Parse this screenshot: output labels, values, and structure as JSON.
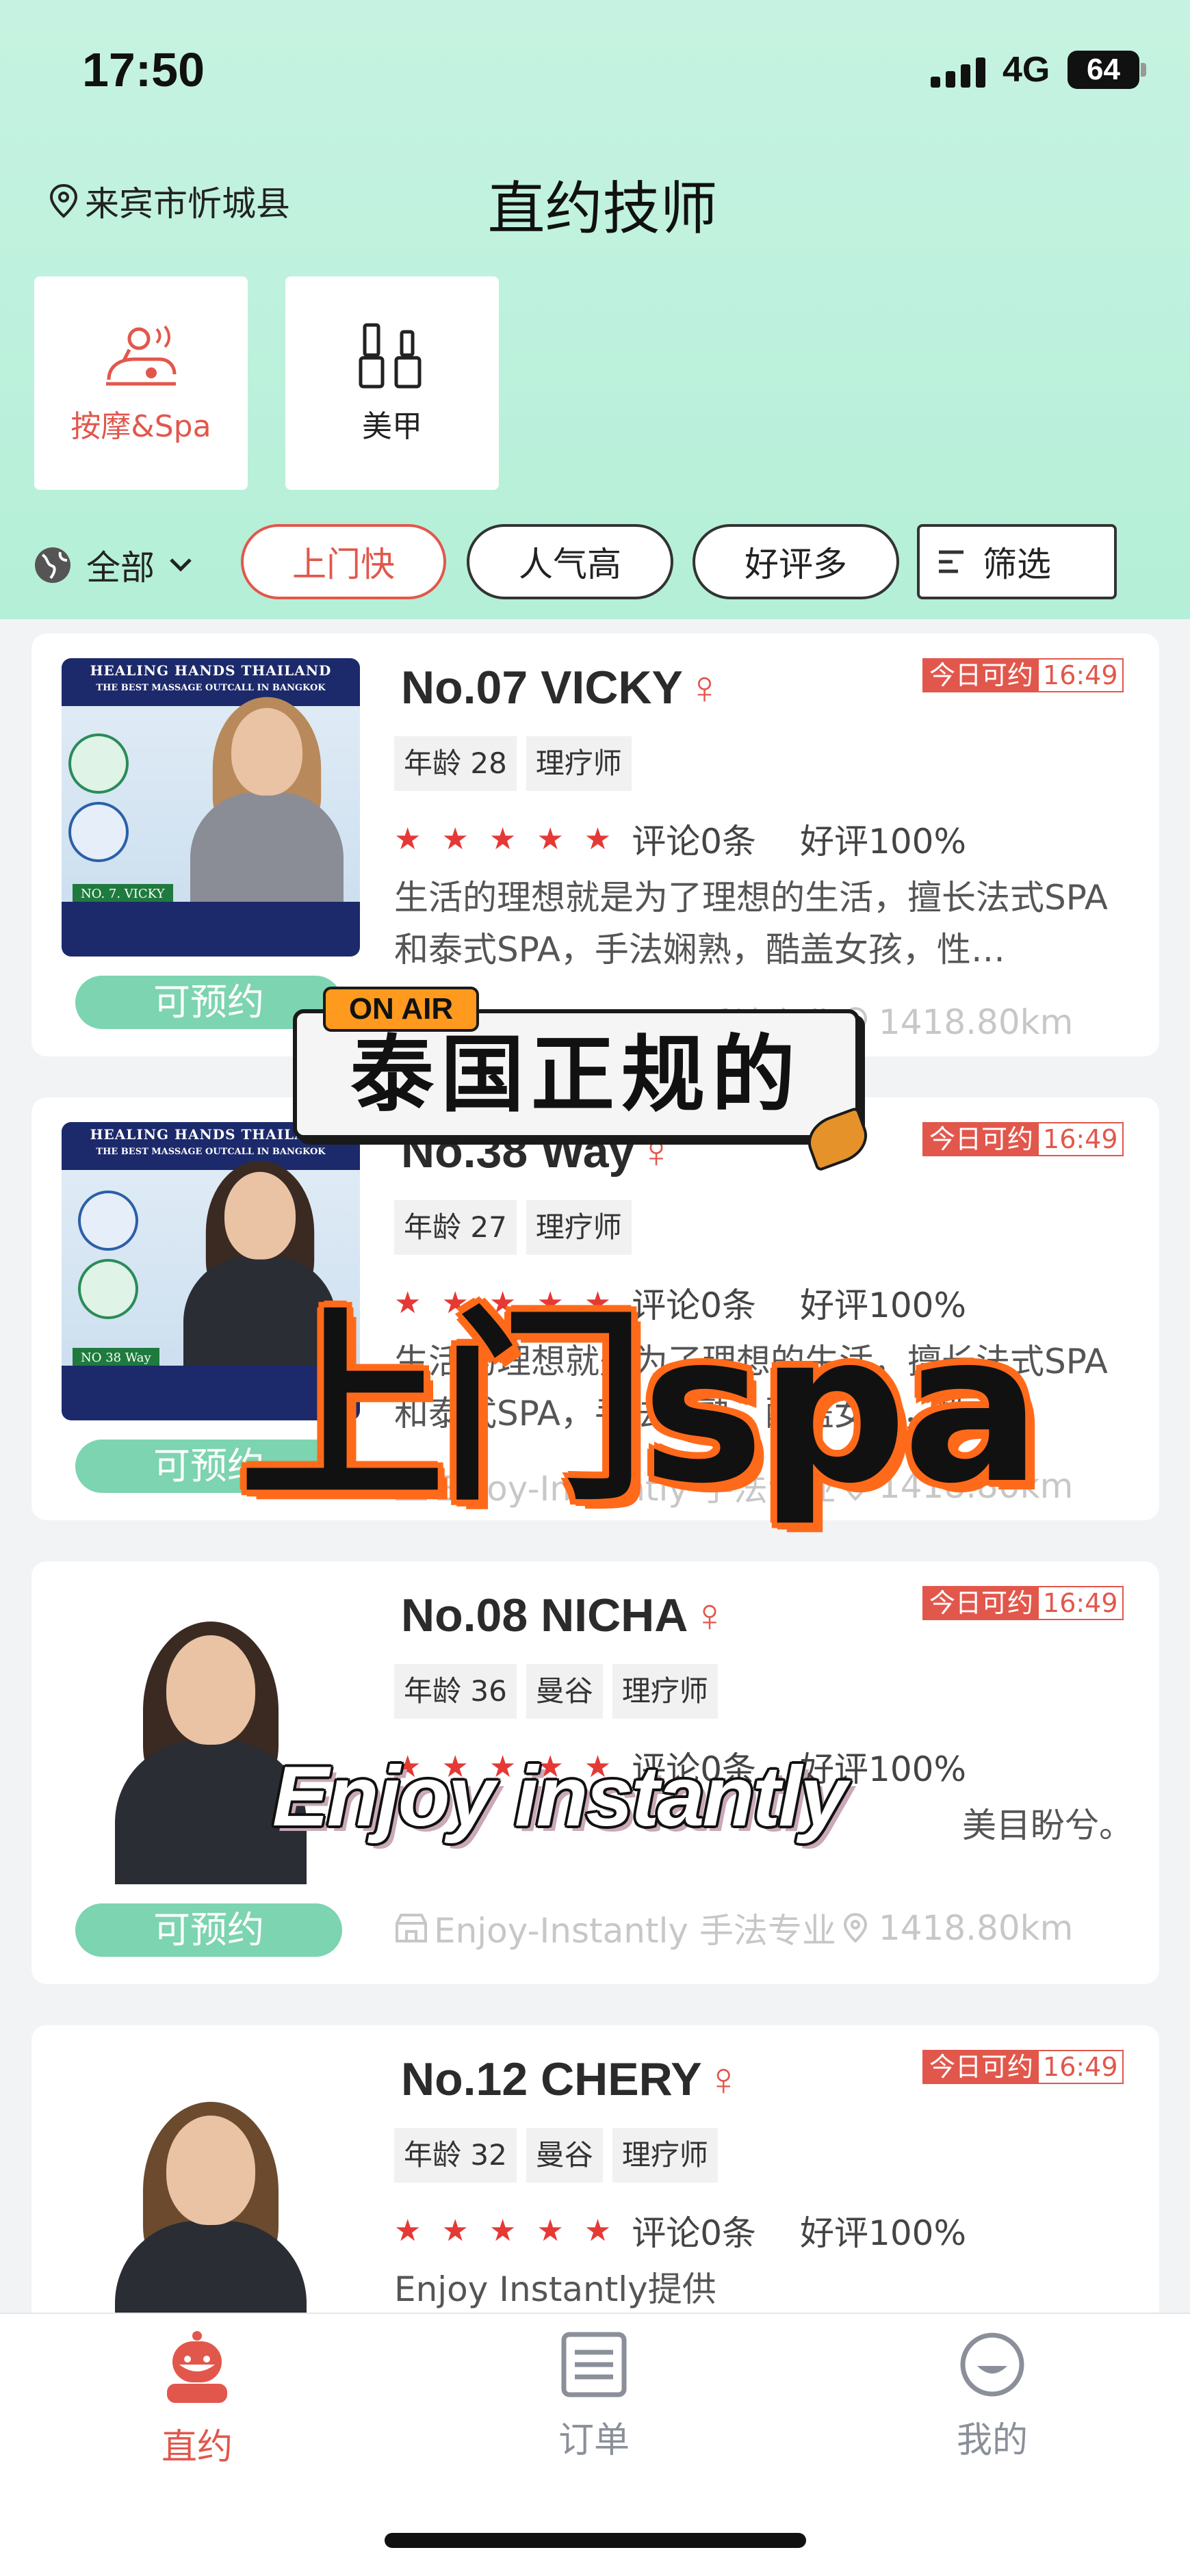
{
  "status_bar": {
    "time": "17:50",
    "network": "4G",
    "battery": "64"
  },
  "header": {
    "location": "来宾市忻城县",
    "title": "直约技师"
  },
  "categories": [
    {
      "label": "按摩&Spa",
      "icon": "massage-icon",
      "active": true
    },
    {
      "label": "美甲",
      "icon": "nail-polish-icon",
      "active": false
    }
  ],
  "filters": {
    "region": "全部",
    "chips": [
      "上门快",
      "人气高",
      "好评多"
    ],
    "filter_label": "筛选"
  },
  "therapists": [
    {
      "name": "No.07 VICKY",
      "gender": "♀",
      "available": "今日可约",
      "time": "16:49",
      "tags": [
        "年龄 28",
        "理疗师"
      ],
      "stars": "★★★★★",
      "reviews": "评论0条",
      "rating": "好评100%",
      "desc": "生活的理想就是为了理想的生活，擅长法式SPA和泰式SPA，手法娴熟，酷盖女孩，性…",
      "shop": "Enjoy-Instantly 手法专业",
      "distance": "1418.80km",
      "book": "可预约",
      "photo": {
        "head1": "HEALING HANDS THAILAND",
        "head2": "THE BEST MASSAGE OUTCALL IN BANGKOK",
        "badge": "NO. 7. VICKY"
      }
    },
    {
      "name": "No.38 Way",
      "gender": "♀",
      "available": "今日可约",
      "time": "16:49",
      "tags": [
        "年龄 27",
        "理疗师"
      ],
      "stars": "★★★★★",
      "reviews": "评论0条",
      "rating": "好评100%",
      "desc": "生活的理想就是为了理想的生活，擅长法式SPA和泰式SPA，手法娴熟，酷盖女孩，性…",
      "shop": "Enjoy-Instantly 手法专业",
      "distance": "1418.80km",
      "book": "可预约",
      "photo": {
        "head1": "HEALING HANDS THAILAND",
        "head2": "THE BEST MASSAGE OUTCALL IN BANGKOK",
        "badge": "NO 38 Way"
      }
    },
    {
      "name": "No.08  NICHA",
      "gender": "♀",
      "available": "今日可约",
      "time": "16:49",
      "tags": [
        "年龄 36",
        "曼谷",
        "理疗师"
      ],
      "stars": "★★★★★",
      "reviews": "评论0条",
      "rating": "好评100%",
      "desc": "美目盼兮。",
      "shop": "Enjoy-Instantly 手法专业",
      "distance": "1418.80km",
      "book": "可预约"
    },
    {
      "name": "No.12  CHERY",
      "gender": "♀",
      "available": "今日可约",
      "time": "16:49",
      "tags": [
        "年龄 32",
        "曼谷",
        "理疗师"
      ],
      "stars": "★★★★★",
      "reviews": "评论0条",
      "rating": "好评100%",
      "desc": "Enjoy  Instantly提供"
    }
  ],
  "overlay": {
    "on_air": "ON AIR",
    "headline": "泰国正规的",
    "big_text": "上门spa",
    "tagline": "Enjoy instantly"
  },
  "bottom_nav": [
    {
      "label": "直约",
      "icon": "robot-avatar-icon",
      "active": true
    },
    {
      "label": "订单",
      "icon": "order-list-icon",
      "active": false
    },
    {
      "label": "我的",
      "icon": "profile-smile-icon",
      "active": false
    }
  ],
  "colors": {
    "accent": "#e2574c",
    "mint": "#7cd4b0",
    "header_bg": "#c0f2de",
    "star": "#e53935"
  }
}
